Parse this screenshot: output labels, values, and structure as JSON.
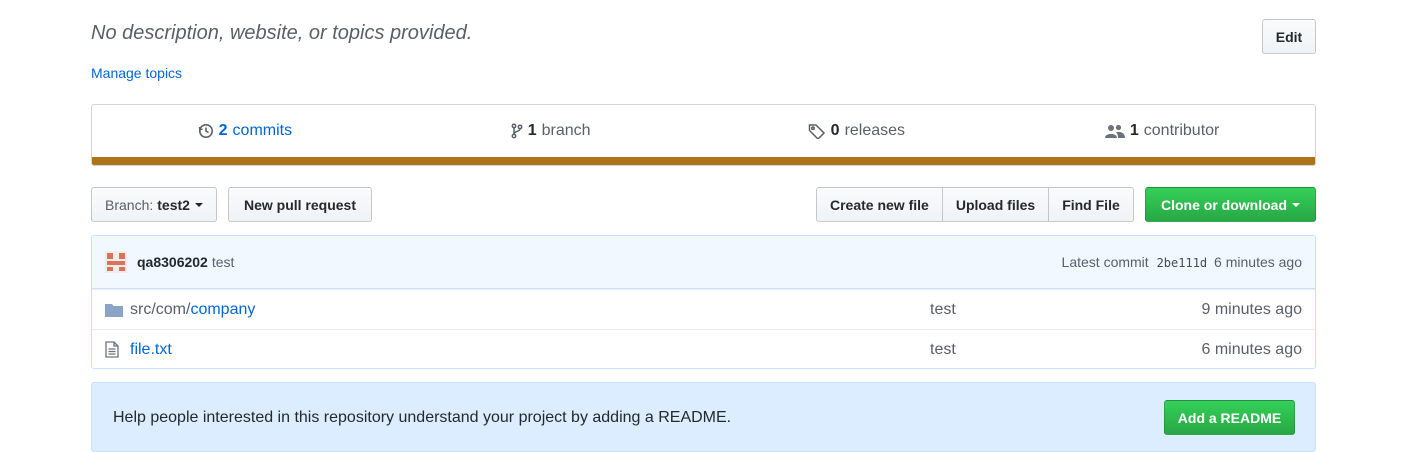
{
  "repo": {
    "description": "No description, website, or topics provided.",
    "manage_topics": "Manage topics",
    "edit_label": "Edit"
  },
  "numbers": {
    "commits": {
      "count": "2",
      "label": "commits"
    },
    "branches": {
      "count": "1",
      "label": "branch"
    },
    "releases": {
      "count": "0",
      "label": "releases"
    },
    "contributors": {
      "count": "1",
      "label": "contributor"
    },
    "language_color": "#b07219"
  },
  "toolbar": {
    "branch_label": "Branch:",
    "branch_value": "test2",
    "new_pull_request": "New pull request",
    "create_new_file": "Create new file",
    "upload_files": "Upload files",
    "find_file": "Find File",
    "clone_or_download": "Clone or download"
  },
  "latest_commit": {
    "author": "qa8306202",
    "message": "test",
    "prefix": "Latest commit",
    "sha": "2be111d",
    "age": "6 minutes ago"
  },
  "files": [
    {
      "type": "directory",
      "path_dim": "src/com/",
      "name": "company",
      "message": "test",
      "age": "9 minutes ago"
    },
    {
      "type": "file",
      "path_dim": "",
      "name": "file.txt",
      "message": "test",
      "age": "6 minutes ago"
    }
  ],
  "readme": {
    "prompt": "Help people interested in this repository understand your project by adding a README.",
    "button": "Add a README"
  },
  "colors": {
    "link": "#0366d6",
    "primary_green": "#28a745",
    "readme_bg": "#dbedff"
  }
}
